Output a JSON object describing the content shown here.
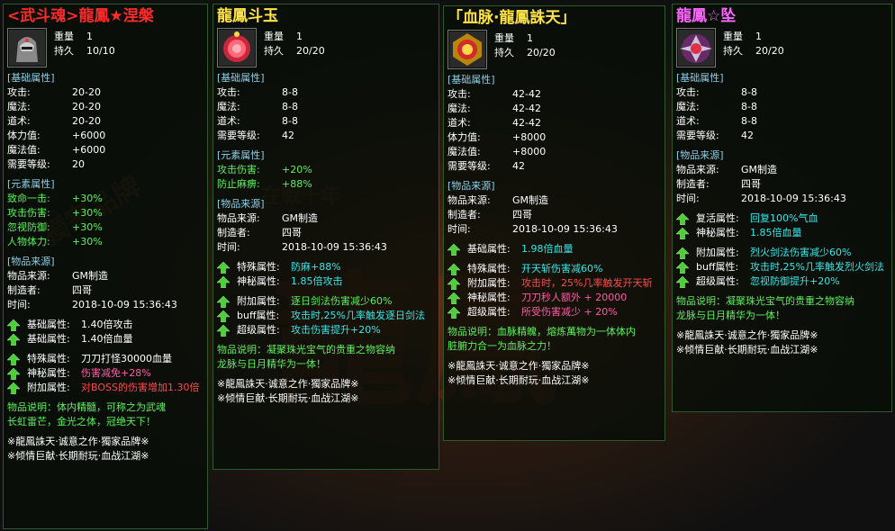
{
  "colors": {
    "green": "#5ef05e",
    "cyan": "#34e8e8",
    "pink": "#ff5aa8",
    "red": "#ff4a4a",
    "section": "#8ecfe8"
  },
  "labels": {
    "weight": "重量",
    "durability": "持久",
    "desc_label": "物品说明："
  },
  "panels": [
    {
      "title": "<武斗魂>龍鳳★涅槃",
      "title_color": "#ff2a2a",
      "icon": "dark-warrior-helmet-icon",
      "weight": "1",
      "durability": "10/10",
      "base_title": "[基础属性]",
      "base": [
        [
          "攻击:",
          "20-20"
        ],
        [
          "魔法:",
          "20-20"
        ],
        [
          "道术:",
          "20-20"
        ],
        [
          "体力值:",
          "+6000"
        ],
        [
          "魔法值:",
          "+6000"
        ],
        [
          "需要等级:",
          "20"
        ]
      ],
      "element_title": "[元素属性]",
      "element": [
        [
          "致命一击:",
          "+30%"
        ],
        [
          "攻击伤害:",
          "+30%"
        ],
        [
          "忽视防御:",
          "+30%"
        ],
        [
          "人物体力:",
          "+30%"
        ]
      ],
      "source_title": "[物品来源]",
      "source": [
        [
          "物品来源:",
          "GM制造"
        ],
        [
          "制造者:",
          "四哥"
        ],
        [
          "时间:",
          "2018-10-09 15:36:43"
        ]
      ],
      "groups": [
        [
          [
            "基础属性:",
            "1.40倍攻击",
            ""
          ],
          [
            "基础属性:",
            "1.40倍血量",
            ""
          ]
        ],
        [
          [
            "特殊属性:",
            "刀刀打怪30000血量",
            ""
          ],
          [
            "神秘属性:",
            "伤害减免+28%",
            "pink"
          ],
          [
            "附加属性:",
            "对BOSS的伤害增加1.30倍",
            "red"
          ]
        ]
      ],
      "desc": "体内精髓，可称之为武魂长虹雷芒，金光之体，冠绝天下！",
      "foot": [
        "※龍鳳誅天·诚意之作·獨家品牌※",
        "※倾情巨献·长期耐玩·血战江湖※"
      ]
    },
    {
      "title": "龍鳳斗玉",
      "title_color": "#ffe44a",
      "icon": "red-jade-icon",
      "weight": "1",
      "durability": "20/20",
      "base_title": "[基础属性]",
      "base": [
        [
          "攻击:",
          "8-8"
        ],
        [
          "魔法:",
          "8-8"
        ],
        [
          "道术:",
          "8-8"
        ],
        [
          "需要等级:",
          "42"
        ]
      ],
      "element_title": "[元素属性]",
      "element": [
        [
          "攻击伤害:",
          "+20%"
        ],
        [
          "防止麻痹:",
          "+88%"
        ]
      ],
      "source_title": "[物品来源]",
      "source": [
        [
          "物品来源:",
          "GM制造"
        ],
        [
          "制造者:",
          "四哥"
        ],
        [
          "时间:",
          "2018-10-09 15:36:43"
        ]
      ],
      "groups": [
        [
          [
            "特殊属性:",
            "防麻+88%",
            "cyan"
          ],
          [
            "神秘属性:",
            "1.85倍攻击",
            "cyan"
          ]
        ],
        [
          [
            "附加属性:",
            "逐日剑法伤害减少60%",
            "green"
          ],
          [
            "buff属性:",
            "攻击时,25%几率触发逐日剑法",
            "cyan"
          ],
          [
            "超级属性:",
            "攻击伤害提升+20%",
            "cyan"
          ]
        ]
      ],
      "desc": "凝聚珠光宝气的贵重之物容纳龙脉与日月精华为一体！",
      "foot": [
        "※龍鳳誅天·诚意之作·獨家品牌※",
        "※倾情巨献·长期耐玩·血战江湖※"
      ]
    },
    {
      "title": "「血脉·龍鳳誅天」",
      "title_color": "#ffe44a",
      "icon": "golden-medal-icon",
      "weight": "1",
      "durability": "20/20",
      "base_title": "[基础属性]",
      "base": [
        [
          "攻击:",
          "42-42"
        ],
        [
          "魔法:",
          "42-42"
        ],
        [
          "道术:",
          "42-42"
        ],
        [
          "体力值:",
          "+8000"
        ],
        [
          "魔法值:",
          "+8000"
        ],
        [
          "需要等级:",
          "42"
        ]
      ],
      "element_title": "",
      "element": [],
      "source_title": "[物品来源]",
      "source": [
        [
          "物品来源:",
          "GM制造"
        ],
        [
          "制造者:",
          "四哥"
        ],
        [
          "时间:",
          "2018-10-09 15:36:43"
        ]
      ],
      "groups": [
        [
          [
            "基础属性:",
            "1.98倍血量",
            "cyan"
          ]
        ],
        [
          [
            "特殊属性:",
            "开天斩伤害减60%",
            "cyan"
          ],
          [
            "附加属性:",
            "攻击时，25%几率触发开天斩",
            "red"
          ],
          [
            "神秘属性:",
            "刀刀秒人额外 + 20000",
            "pink"
          ],
          [
            "超级属性:",
            "所受伤害减少 + 20%",
            "pink"
          ]
        ]
      ],
      "desc": "血脉精魄，熔炼萬物为一体体内脏腑力合一为血脉之力！",
      "foot": [
        "※龍鳳誅天·诚意之作·獨家品牌※",
        "※倾情巨献·长期耐玩·血战江湖※"
      ]
    },
    {
      "title": "龍鳳☆坠",
      "title_color": "#ff66ff",
      "icon": "ornate-pendant-icon",
      "weight": "1",
      "durability": "20/20",
      "base_title": "[基础属性]",
      "base": [
        [
          "攻击:",
          "8-8"
        ],
        [
          "魔法:",
          "8-8"
        ],
        [
          "道术:",
          "8-8"
        ],
        [
          "需要等级:",
          "42"
        ]
      ],
      "element_title": "",
      "element": [],
      "source_title": "[物品来源]",
      "source": [
        [
          "物品来源:",
          "GM制造"
        ],
        [
          "制造者:",
          "四哥"
        ],
        [
          "时间:",
          "2018-10-09 15:36:43"
        ]
      ],
      "groups": [
        [
          [
            "复活属性:",
            "回复100%气血",
            "cyan"
          ],
          [
            "神秘属性:",
            "1.85倍血量",
            "cyan"
          ]
        ],
        [
          [
            "附加属性:",
            "烈火剑法伤害减少60%",
            "cyan"
          ],
          [
            "buff属性:",
            "攻击时,25%几率触发烈火剑法",
            "cyan"
          ],
          [
            "超级属性:",
            "忽视防御提升+20%",
            "cyan"
          ]
        ]
      ],
      "desc": "凝聚珠光宝气的贵重之物容纳龙脉与日月精华为一体！",
      "foot": [
        "※龍鳳誅天·诚意之作·獨家品牌※",
        "※倾情巨献·长期耐玩·血战江湖※"
      ]
    }
  ]
}
